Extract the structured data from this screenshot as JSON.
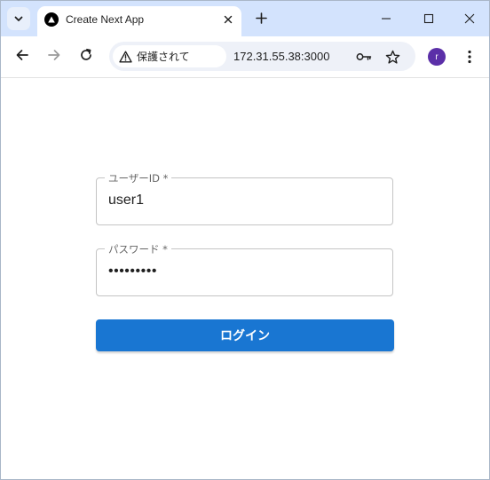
{
  "browser": {
    "tab": {
      "title": "Create Next App"
    },
    "new_tab_symbol": "+",
    "address_bar": {
      "security_label": "保護されてい",
      "url": "172.31.55.38:3000"
    },
    "profile": {
      "initial": "r",
      "color": "#5b2fa8"
    },
    "icons": {
      "tab_search": "chevron-down-icon",
      "favicon": "nextjs-triangle-icon",
      "close": "close-icon",
      "minimize": "minimize-icon",
      "maximize": "maximize-icon",
      "window_close": "close-icon",
      "back": "arrow-left-icon",
      "forward": "arrow-right-icon",
      "reload": "reload-icon",
      "warning": "warning-icon",
      "password_key": "key-icon",
      "bookmark": "star-icon",
      "menu": "kebab-menu-icon"
    }
  },
  "login_form": {
    "user_id": {
      "label": "ユーザーID *",
      "value": "user1"
    },
    "password": {
      "label": "パスワード *",
      "value": "•••••••••"
    },
    "submit_label": "ログイン",
    "accent_color": "#1976d2"
  }
}
